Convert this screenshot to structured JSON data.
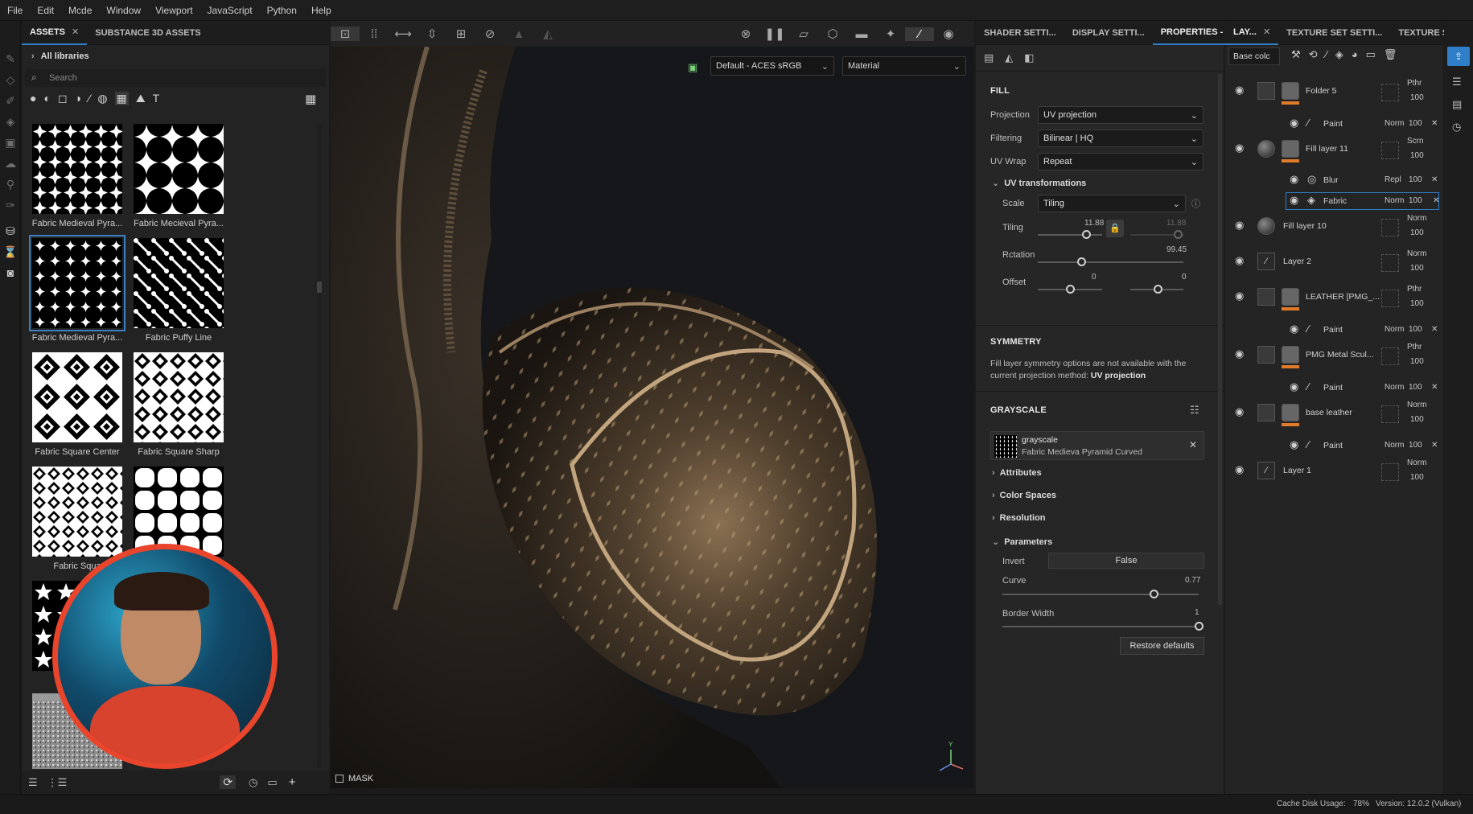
{
  "menu": [
    "File",
    "Edit",
    "Mcde",
    "Window",
    "Viewport",
    "JavaScript",
    "Python",
    "Help"
  ],
  "assets": {
    "tabs": [
      {
        "label": "ASSETS",
        "close": "✕"
      },
      {
        "label": "SUBSTANCE 3D ASSETS"
      }
    ],
    "library": "All libraries",
    "search_placeholder": "Search",
    "items": [
      {
        "label": "Fabric Medieval Pyra..."
      },
      {
        "label": "Fabric Mecieval Pyra..."
      },
      {
        "label": "Fabric Medieval Pyra..."
      },
      {
        "label": "Fabric Puffy Line"
      },
      {
        "label": "Fabric Square Center"
      },
      {
        "label": "Fabric Square Sharp"
      },
      {
        "label": "Fabric Squa"
      },
      {
        "label": ""
      },
      {
        "label": "Fabri"
      }
    ],
    "bottom_add": "+"
  },
  "viewport": {
    "colorspace": "Default - ACES sRGB",
    "mode": "Material",
    "mask_label": "MASK",
    "axis_y": "Y"
  },
  "properties": {
    "tabs": [
      "SHADER SETTI...",
      "DISPLAY SETTI...",
      "PROPERTIES - F..."
    ],
    "close": "✕",
    "fill_title": "FILL",
    "projection_label": "Projection",
    "projection_value": "UV projection",
    "filtering_label": "Filtering",
    "filtering_value": "Bilinear | HQ",
    "uvwrap_label": "UV Wrap",
    "uvwrap_value": "Repeat",
    "uv_transformations": "UV transformations",
    "scale_label": "Scale",
    "scale_value": "Tiling",
    "tiling_label": "Tiling",
    "tiling_value_1": "11.88",
    "tiling_value_2": "11.88",
    "rotation_label": "Rctation",
    "rotation_value": "99.45",
    "offset_label": "Offset",
    "offset_value_1": "0",
    "offset_value_2": "0",
    "symmetry_title": "SYMMETRY",
    "symmetry_text_1": "Fill layer symmetry options are not available with the",
    "symmetry_text_2": "current projection method:",
    "symmetry_method": "UV projection",
    "grayscale_title": "GRAYSCALE",
    "grayscale_resource_name": "grayscale",
    "grayscale_resource_sub": "Fabric Medieva Pyramid Curved",
    "attributes": "Attributes",
    "color_spaces": "Color Spaces",
    "resolution": "Resolution",
    "parameters": "Parameters",
    "invert_label": "Invert",
    "invert_value": "False",
    "curve_label": "Curve",
    "curve_value": "0.77",
    "curve_fraction": 0.77,
    "border_label": "Border Width",
    "border_value": "1",
    "border_fraction": 1.0,
    "restore_label": "Restore defaults"
  },
  "layers": {
    "tabs": [
      "LAY...",
      "TEXTURE SET SETTI...",
      "TEXTURE SET ..."
    ],
    "close": "✕",
    "channel": "Base colc",
    "rows": [
      {
        "name": "Folder 5",
        "blend": "Pthr",
        "opacity": "100",
        "kind": "folder"
      },
      {
        "name": "Paint",
        "blend": "Norm",
        "opacity": "100",
        "kind": "effect",
        "remove": "✕"
      },
      {
        "name": "Fill layer 11",
        "blend": "Scrn",
        "opacity": "100",
        "kind": "fill"
      },
      {
        "name": "Blur",
        "blend": "Repl",
        "opacity": "100",
        "kind": "effect",
        "remove": "✕"
      },
      {
        "name": "Fabric",
        "blend": "Norm",
        "opacity": "100",
        "kind": "effect-selected",
        "remove": "✕"
      },
      {
        "name": "Fill layer 10",
        "blend": "Norm",
        "opacity": "100",
        "kind": "fill"
      },
      {
        "name": "Layer 2",
        "blend": "Norm",
        "opacity": "100",
        "kind": "paint"
      },
      {
        "name": "LEATHER [PMG_...",
        "blend": "Pthr",
        "opacity": "100",
        "kind": "folder"
      },
      {
        "name": "Paint",
        "blend": "Norm",
        "opacity": "100",
        "kind": "effect",
        "remove": "✕"
      },
      {
        "name": "PMG Metal Scul...",
        "blend": "Pthr",
        "opacity": "100",
        "kind": "folder"
      },
      {
        "name": "Paint",
        "blend": "Norm",
        "opacity": "100",
        "kind": "effect",
        "remove": "✕"
      },
      {
        "name": "base leather",
        "blend": "Norm",
        "opacity": "100",
        "kind": "folder"
      },
      {
        "name": "Paint",
        "blend": "Norm",
        "opacity": "100",
        "kind": "effect",
        "remove": "✕"
      },
      {
        "name": "Layer 1",
        "blend": "Norm",
        "opacity": "100",
        "kind": "paint"
      }
    ]
  },
  "status": {
    "cache_label": "Cache Disk Usage:",
    "cache_value": "78%",
    "version": "Version: 12.0.2 (Vulkan)"
  },
  "colors": {
    "accent": "#2f7ec8",
    "orange": "#e07b2a",
    "webcam_ring": "#e8452c"
  }
}
